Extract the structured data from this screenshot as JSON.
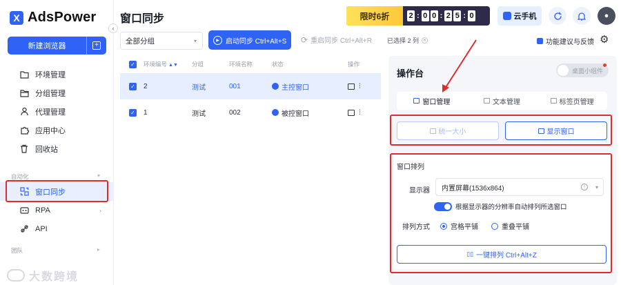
{
  "app": {
    "logo_letter": "X",
    "name": "AdsPower"
  },
  "sidebar": {
    "new_browser": "新建浏览器",
    "new_browser_icon": "+",
    "items": [
      {
        "label": "环境管理",
        "icon": "folder-icon"
      },
      {
        "label": "分组管理",
        "icon": "folder-open-icon"
      },
      {
        "label": "代理管理",
        "icon": "proxy-icon"
      },
      {
        "label": "应用中心",
        "icon": "puzzle-icon"
      },
      {
        "label": "回收站",
        "icon": "trash-icon"
      }
    ],
    "section_automation": "自动化",
    "automation_items": [
      {
        "label": "窗口同步",
        "icon": "sync-window-icon",
        "active": true
      },
      {
        "label": "RPA",
        "icon": "rpa-icon"
      },
      {
        "label": "API",
        "icon": "api-icon"
      }
    ],
    "section_team": "团队"
  },
  "watermark": "大数跨境",
  "header": {
    "title": "窗口同步",
    "promo_label": "限时6折",
    "countdown": [
      "2",
      "0",
      "0",
      "2",
      "5",
      "0"
    ],
    "cloud_phone": "云手机"
  },
  "toolbar": {
    "group_select": "全部分组",
    "start_sync": "启动同步 Ctrl+Alt+S",
    "restart_sync": "重启同步 Ctrl+Alt+R",
    "selected_count": "已选择 2 列",
    "feedback": "功能建议与反馈"
  },
  "table": {
    "headers": [
      "环境编号",
      "分组",
      "环境名称",
      "状态",
      "操作"
    ],
    "rows": [
      {
        "num": "2",
        "group": "测试",
        "name": "001",
        "status": "主控窗口",
        "selected": true
      },
      {
        "num": "1",
        "group": "测试",
        "name": "002",
        "status": "被控窗口",
        "selected": true
      }
    ]
  },
  "panel": {
    "title": "操作台",
    "widget_toggle": "桌面小组件",
    "tabs": [
      "窗口管理",
      "文本管理",
      "标签页管理"
    ],
    "unify_size": "统一大小",
    "show_window": "显示窗口",
    "arrange_title": "窗口排列",
    "display_label": "显示器",
    "display_value": "内置屏幕(1536x864)",
    "auto_arrange": "根据显示器的分辨率自动排列所选窗口",
    "mode_label": "排列方式",
    "mode_grid": "宫格平铺",
    "mode_overlap": "重叠平铺",
    "one_key": "一键排列 Ctrl+Alt+Z"
  },
  "colors": {
    "primary": "#2f63f5",
    "highlight_red": "#e02b2b"
  }
}
